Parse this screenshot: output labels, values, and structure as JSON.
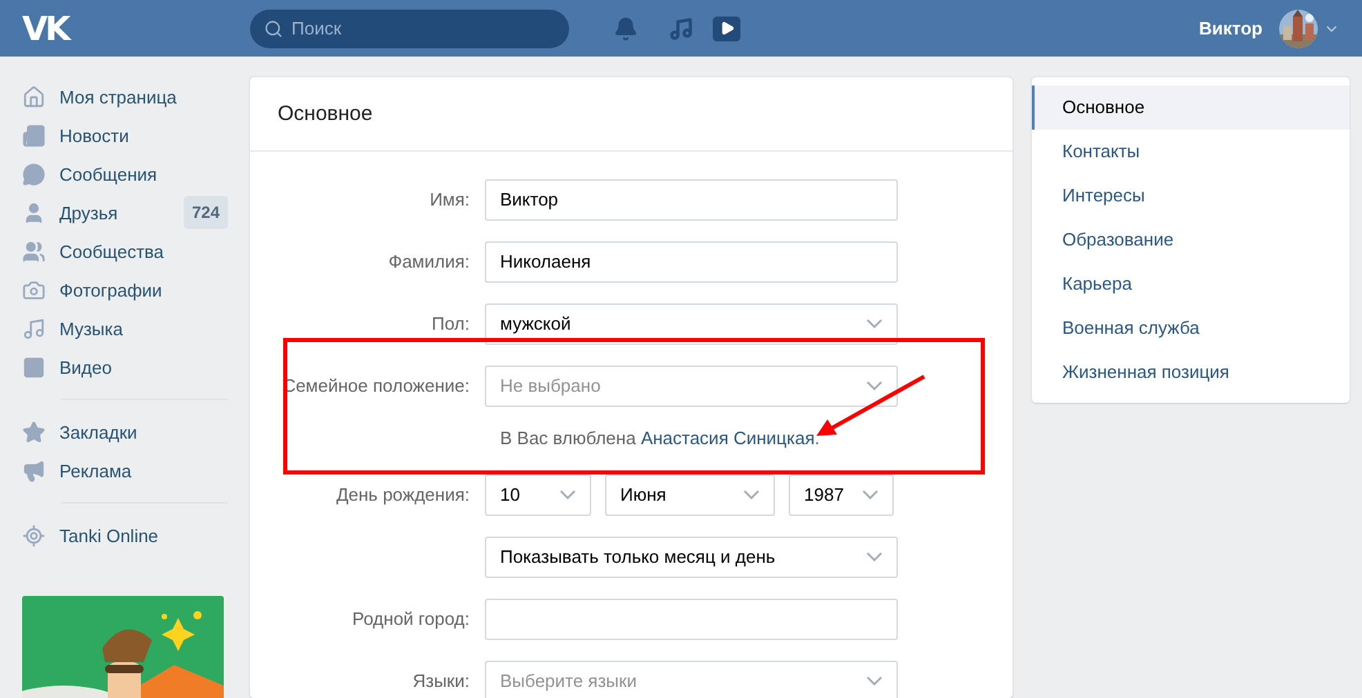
{
  "header": {
    "logo": "VK",
    "search": {
      "placeholder": "Поиск"
    },
    "user": {
      "name": "Виктор"
    }
  },
  "sidebar": {
    "groups": [
      [
        {
          "label": "Моя страница"
        },
        {
          "label": "Новости"
        },
        {
          "label": "Сообщения"
        },
        {
          "label": "Друзья",
          "count": "724"
        },
        {
          "label": "Сообщества"
        },
        {
          "label": "Фотографии"
        },
        {
          "label": "Музыка"
        },
        {
          "label": "Видео"
        }
      ],
      [
        {
          "label": "Закладки"
        },
        {
          "label": "Реклама"
        }
      ],
      [
        {
          "label": "Tanki Online"
        }
      ]
    ],
    "ad": {
      "kind": "picture"
    }
  },
  "form": {
    "title": "Основное",
    "rows": [
      {
        "kind": "fields",
        "label": "Имя:",
        "fields": [
          {
            "kind": "text",
            "value": "Виктор"
          }
        ]
      },
      {
        "kind": "fields",
        "label": "Фамилия:",
        "fields": [
          {
            "kind": "text",
            "value": "Николаеня"
          }
        ]
      },
      {
        "kind": "fields",
        "label": "Пол:",
        "fields": [
          {
            "kind": "select",
            "value": "мужской"
          }
        ]
      },
      {
        "kind": "fields",
        "label": "Семейное положение:",
        "fields": [
          {
            "kind": "select",
            "placeholder": "Не выбрано"
          }
        ]
      },
      {
        "kind": "note",
        "prefix": "В Вас влюблена ",
        "link": "Анастасия Синицкая",
        "suffix": "."
      },
      {
        "kind": "fields",
        "label": "День рождения:",
        "fields": [
          {
            "kind": "select",
            "value": "10"
          },
          {
            "kind": "select",
            "value": "Июня"
          },
          {
            "kind": "select",
            "value": "1987"
          }
        ]
      },
      {
        "kind": "fields",
        "fields": [
          {
            "kind": "select",
            "value": "Показывать только месяц и день"
          }
        ]
      },
      {
        "kind": "fields",
        "label": "Родной город:",
        "fields": [
          {
            "kind": "text"
          }
        ]
      },
      {
        "kind": "fields",
        "label": "Языки:",
        "fields": [
          {
            "kind": "select",
            "placeholder": "Выберите языки"
          }
        ]
      }
    ]
  },
  "menu": [
    {
      "label": "Основное",
      "selected": true
    },
    {
      "label": "Контакты",
      "selected": false
    },
    {
      "label": "Интересы",
      "selected": false
    },
    {
      "label": "Образование",
      "selected": false
    },
    {
      "label": "Карьера",
      "selected": false
    },
    {
      "label": "Военная служба",
      "selected": false
    },
    {
      "label": "Жизненная позиция",
      "selected": false
    }
  ]
}
